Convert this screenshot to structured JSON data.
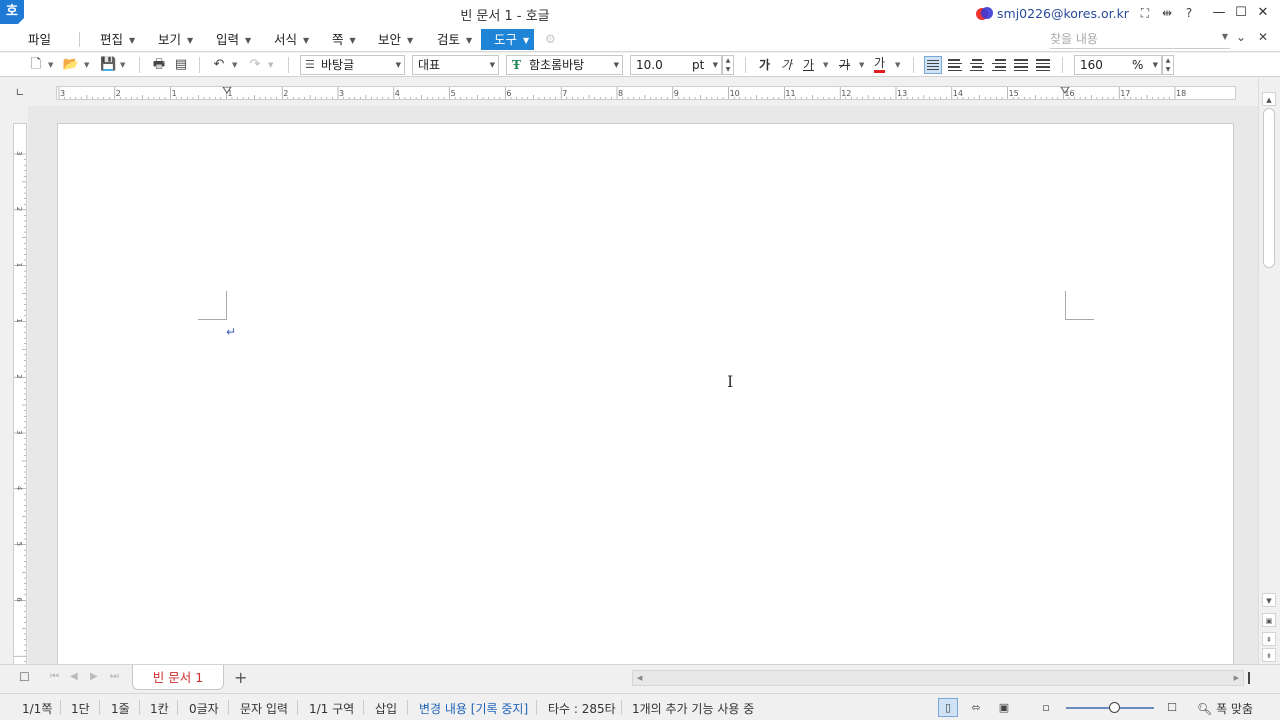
{
  "title": {
    "text": "빈 문서 1 - 호글",
    "app_logo": "호"
  },
  "user": {
    "email": "smj0226@kores.or.kr"
  },
  "title_buttons": {
    "fullscreen": "⛶",
    "dock": "⇹",
    "help": "?"
  },
  "window_buttons": {
    "minimize": "—",
    "maximize": "☐",
    "close": "✕"
  },
  "menu": {
    "file": "파일",
    "items": [
      {
        "label": "편집"
      },
      {
        "label": "보기"
      },
      {
        "label": "입력"
      },
      {
        "label": "서식"
      },
      {
        "label": "쪽"
      },
      {
        "label": "보안"
      },
      {
        "label": "검토"
      },
      {
        "label": "도구"
      }
    ],
    "find_placeholder": "찾을 내용"
  },
  "toolbar": {
    "style": "바탕글",
    "lang": "대표",
    "font": "함초롬바탕",
    "font_size": "10.0",
    "size_unit": "pt",
    "bold_label": "가",
    "italic_label": "가",
    "underline_label": "가",
    "strike_label": "가",
    "color_label": "가",
    "zoom": "160",
    "zoom_unit": "%"
  },
  "ruler": {
    "h_ticks": [
      "3",
      "2",
      "1",
      "1",
      "2",
      "3",
      "4",
      "5",
      "6",
      "7",
      "8",
      "9",
      "10",
      "11",
      "12",
      "13",
      "14",
      "15",
      "16",
      "17",
      "18"
    ],
    "v_ticks": [
      "3",
      "2",
      "1",
      "1",
      "2",
      "3",
      "4",
      "5",
      "6"
    ]
  },
  "tab": {
    "name": "빈 문서 1",
    "add": "+"
  },
  "status": {
    "page": "1/1쪽",
    "column": "1단",
    "line": "1줄",
    "cell": "1칸",
    "chars": "0글자",
    "input_mode": "문자 입력",
    "section": "1/1 구역",
    "insert": "삽입",
    "track": "변경 내용 [기록 중지]",
    "typing": "타수 : 285타",
    "addons": "1개의 추가 기능 사용 중",
    "fit": "폭 맞춤"
  },
  "colors": {
    "accent": "#1f84d6",
    "tab_text": "#d03030",
    "status_link": "#1f63b8"
  }
}
